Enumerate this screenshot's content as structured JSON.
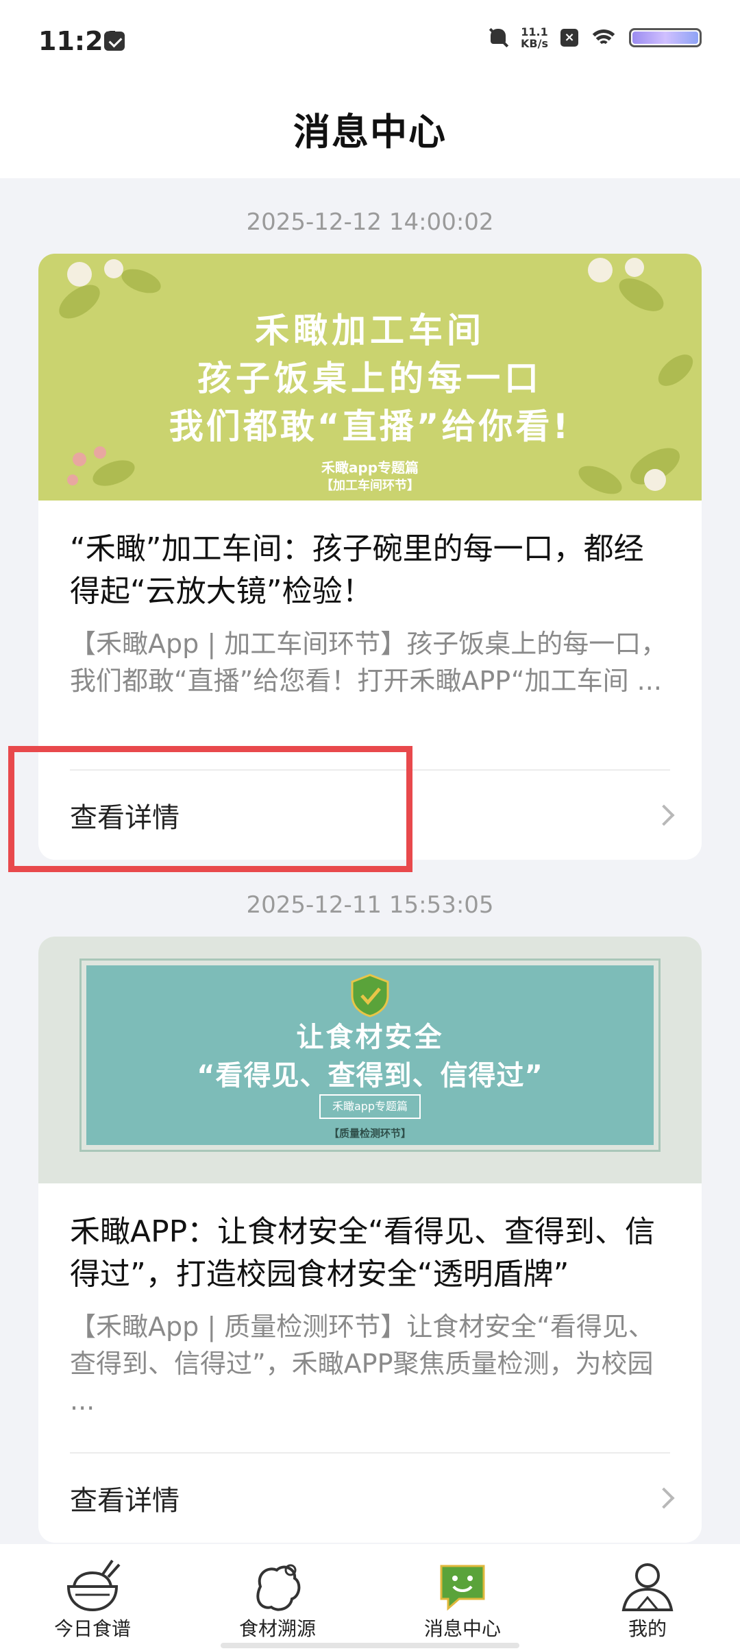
{
  "status_bar": {
    "time": "11:21",
    "speed_value": "11.1",
    "speed_unit": "KB/s",
    "icons": [
      "message-icon",
      "bell-muted-icon",
      "x-box-icon",
      "wifi-icon",
      "battery-icon"
    ]
  },
  "header": {
    "title": "消息中心"
  },
  "messages": [
    {
      "timestamp": "2025-12-12 14:00:02",
      "banner": {
        "line1": "禾瞰加工车间",
        "line2": "孩子饭桌上的每一口",
        "line3": "我们都敢“直播”给你看!",
        "tag1": "禾瞰app专题篇",
        "tag2": "【加工车间环节】"
      },
      "title": "“禾瞰”加工车间：孩子碗里的每一口，都经得起“云放大镜”检验！",
      "summary": "【禾瞰App | 加工车间环节】孩子饭桌上的每一口，我们都敢“直播”给您看！打开禾瞰APP“加工车间 ...",
      "link_label": "查看详情"
    },
    {
      "timestamp": "2025-12-11 15:53:05",
      "banner": {
        "line1": "让食材安全",
        "line2": "“看得见、查得到、信得过”",
        "tag1": "禾瞰app专题篇",
        "tag2": "【质量检测环节】"
      },
      "title": "禾瞰APP：让食材安全“看得见、查得到、信得过”，打造校园食材安全“透明盾牌”",
      "summary": "【禾瞰App | 质量检测环节】让食材安全“看得见、查得到、信得过”，禾瞰APP聚焦质量检测，为校园 ...",
      "link_label": "查看详情"
    }
  ],
  "tabbar": {
    "tabs": [
      {
        "label": "今日食谱",
        "icon": "bowl-icon",
        "active": false
      },
      {
        "label": "食材溯源",
        "icon": "food-trace-icon",
        "active": false
      },
      {
        "label": "消息中心",
        "icon": "message-smile-icon",
        "active": true
      },
      {
        "label": "我的",
        "icon": "person-icon",
        "active": false
      }
    ]
  },
  "colors": {
    "accent": "#5aa33a",
    "highlight_box": "#e8494c",
    "banner1_bg": "#cad36f",
    "banner2_panel": "#7dbcb8"
  }
}
